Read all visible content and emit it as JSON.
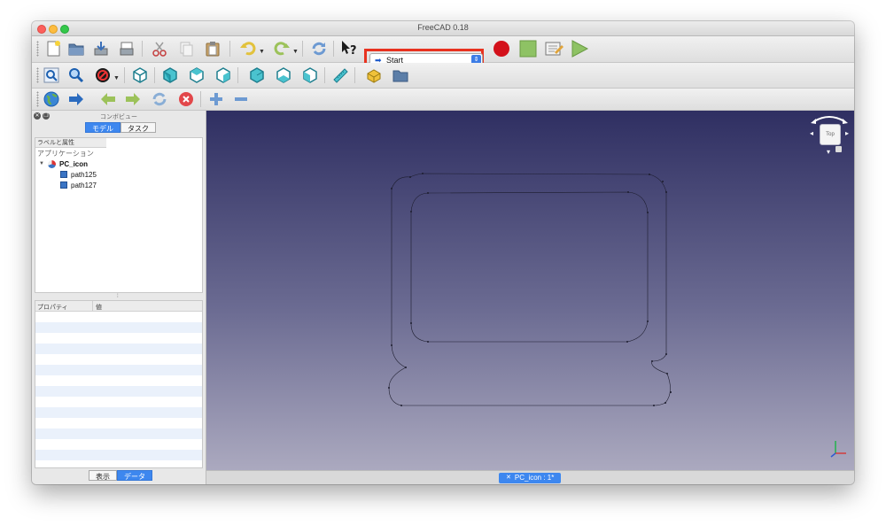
{
  "window": {
    "title": "FreeCAD 0.18"
  },
  "workbench": {
    "selected": "Start"
  },
  "icons": {
    "toolbar1": [
      "new-document-icon",
      "open-folder-icon",
      "save-icon",
      "save-as-icon",
      "cut-icon",
      "copy-icon",
      "paste-icon",
      "undo-icon",
      "redo-icon",
      "refresh-icon",
      "whats-this-icon"
    ],
    "toolbar1_macro": [
      "record-macro-icon",
      "stop-macro-icon",
      "edit-macro-icon",
      "run-macro-icon"
    ],
    "toolbar2": [
      "fit-all-icon",
      "fit-selection-icon",
      "draw-style-icon",
      "isometric-view-icon",
      "front-view-icon",
      "top-view-icon",
      "right-view-icon",
      "rear-view-icon",
      "bottom-view-icon",
      "left-view-icon",
      "measure-distance-icon",
      "create-part-icon",
      "create-group-icon"
    ],
    "toolbar3": [
      "web-browser-icon",
      "set-url-icon",
      "navigate-back-icon",
      "navigate-forward-icon",
      "refresh-web-icon",
      "stop-loading-icon",
      "zoom-in-icon",
      "zoom-out-icon"
    ]
  },
  "combo_view": {
    "title": "コンボビュー",
    "tabs": [
      {
        "label": "モデル",
        "active": true
      },
      {
        "label": "タスク",
        "active": false
      }
    ],
    "tree_header": "ラベルと属性",
    "section": "アプリケーション",
    "document": "PC_icon",
    "objects": [
      "path125",
      "path127"
    ],
    "property_headers": [
      "プロパティ",
      "値"
    ],
    "bottom_tabs": [
      {
        "label": "表示",
        "active": false
      },
      {
        "label": "データ",
        "active": true
      }
    ]
  },
  "navcube": {
    "face": "Top"
  },
  "document_tab": {
    "label": "PC_icon : 1*"
  },
  "colors": {
    "highlight_box": "#e8321f",
    "accent": "#3d87ef",
    "viewport_top": "#2f2f62",
    "viewport_bottom": "#aba9bf"
  }
}
